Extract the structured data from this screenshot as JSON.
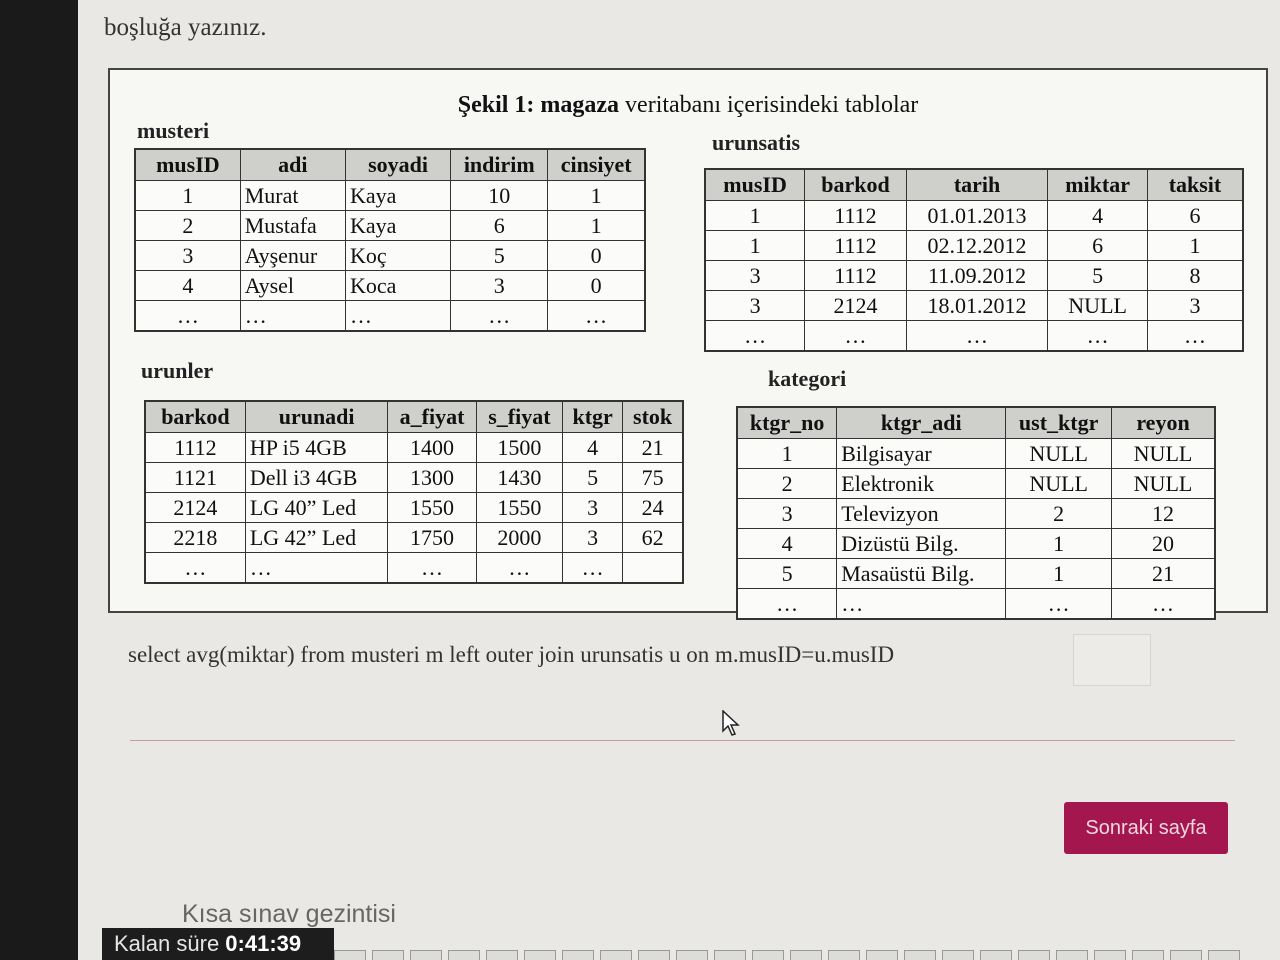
{
  "question": {
    "intro_text": "boşluğa yazınız.",
    "figure_title_bold": "Şekil 1: magaza",
    "figure_title_rest": " veritabanı içerisindeki tablolar"
  },
  "musteri": {
    "name": "musteri",
    "headers": [
      "musID",
      "adi",
      "soyadi",
      "indirim",
      "cinsiyet"
    ],
    "rows": [
      [
        "1",
        "Murat",
        "Kaya",
        "10",
        "1"
      ],
      [
        "2",
        "Mustafa",
        "Kaya",
        "6",
        "1"
      ],
      [
        "3",
        "Ayşenur",
        "Koç",
        "5",
        "0"
      ],
      [
        "4",
        "Aysel",
        "Koca",
        "3",
        "0"
      ],
      [
        "…",
        "…",
        "…",
        "…",
        "…"
      ]
    ]
  },
  "urunsatis": {
    "name": "urunsatis",
    "headers": [
      "musID",
      "barkod",
      "tarih",
      "miktar",
      "taksit"
    ],
    "rows": [
      [
        "1",
        "1112",
        "01.01.2013",
        "4",
        "6"
      ],
      [
        "1",
        "1112",
        "02.12.2012",
        "6",
        "1"
      ],
      [
        "3",
        "1112",
        "11.09.2012",
        "5",
        "8"
      ],
      [
        "3",
        "2124",
        "18.01.2012",
        "NULL",
        "3"
      ],
      [
        "…",
        "…",
        "…",
        "…",
        "…"
      ]
    ]
  },
  "urunler": {
    "name": "urunler",
    "headers": [
      "barkod",
      "urunadi",
      "a_fiyat",
      "s_fiyat",
      "ktgr",
      "stok"
    ],
    "rows": [
      [
        "1112",
        "HP i5 4GB",
        "1400",
        "1500",
        "4",
        "21"
      ],
      [
        "1121",
        "Dell i3 4GB",
        "1300",
        "1430",
        "5",
        "75"
      ],
      [
        "2124",
        "LG 40” Led",
        "1550",
        "1550",
        "3",
        "24"
      ],
      [
        "2218",
        "LG 42” Led",
        "1750",
        "2000",
        "3",
        "62"
      ],
      [
        "…",
        "…",
        "…",
        "…",
        "…",
        ""
      ]
    ]
  },
  "kategori": {
    "name": "kategori",
    "headers": [
      "ktgr_no",
      "ktgr_adi",
      "ust_ktgr",
      "reyon"
    ],
    "rows": [
      [
        "1",
        "Bilgisayar",
        "NULL",
        "NULL"
      ],
      [
        "2",
        "Elektronik",
        "NULL",
        "NULL"
      ],
      [
        "3",
        "Televizyon",
        "2",
        "12"
      ],
      [
        "4",
        "Dizüstü Bilg.",
        "1",
        "20"
      ],
      [
        "5",
        "Masaüstü Bilg.",
        "1",
        "21"
      ],
      [
        "…",
        "…",
        "…",
        "…"
      ]
    ]
  },
  "query": {
    "text": "select avg(miktar) from musteri m left outer join urunsatis u on m.musID=u.musID",
    "answer_value": ""
  },
  "buttons": {
    "next_label": "Sonraki sayfa"
  },
  "footer": {
    "quiz_nav_label": "Kısa sınav gezintisi",
    "timer_label": "Kalan süre ",
    "timer_value": "0:41:39"
  }
}
